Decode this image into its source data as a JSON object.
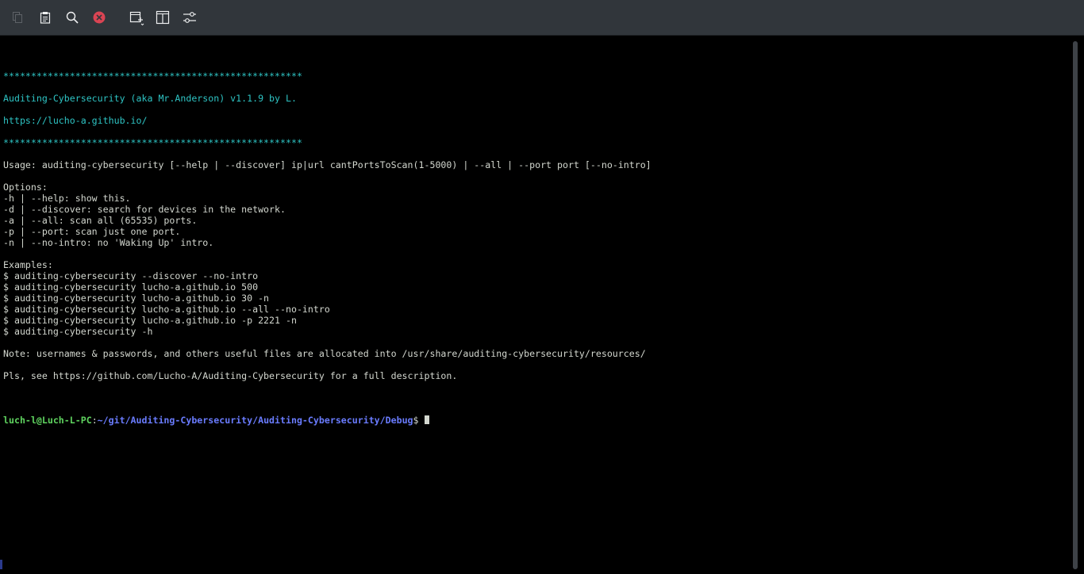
{
  "toolbar": {
    "buttons": [
      {
        "name": "copy",
        "icon": "copy-icon",
        "enabled": false
      },
      {
        "name": "paste",
        "icon": "paste-icon",
        "enabled": true
      },
      {
        "name": "find",
        "icon": "search-icon",
        "enabled": true
      },
      {
        "name": "close",
        "icon": "close-icon",
        "enabled": true,
        "color": "#da4453"
      },
      {
        "name": "new-tab",
        "icon": "new-tab-icon",
        "enabled": true
      },
      {
        "name": "split-view",
        "icon": "split-view-icon",
        "enabled": true
      },
      {
        "name": "settings",
        "icon": "settings-sliders-icon",
        "enabled": true
      }
    ]
  },
  "colors": {
    "toolbar_bg": "#31363b",
    "terminal_bg": "#000000",
    "text": "#d3d7cf",
    "cyan": "#2ec4c4",
    "prompt_user": "#5fd35f",
    "prompt_path": "#6a7cff",
    "close_red": "#da4453"
  },
  "terminal": {
    "lines": [
      {
        "text": "******************************************************",
        "style": "cyan"
      },
      {
        "text": "",
        "style": ""
      },
      {
        "text": "Auditing-Cybersecurity (aka Mr.Anderson) v1.1.9 by L.",
        "style": "cyan"
      },
      {
        "text": "",
        "style": ""
      },
      {
        "text": "https://lucho-a.github.io/",
        "style": "cyan"
      },
      {
        "text": "",
        "style": ""
      },
      {
        "text": "******************************************************",
        "style": "cyan"
      },
      {
        "text": "",
        "style": ""
      },
      {
        "text": "Usage: auditing-cybersecurity [--help | --discover] ip|url cantPortsToScan(1-5000) | --all | --port port [--no-intro]",
        "style": ""
      },
      {
        "text": "",
        "style": ""
      },
      {
        "text": "Options:",
        "style": ""
      },
      {
        "text": "-h | --help: show this.",
        "style": ""
      },
      {
        "text": "-d | --discover: search for devices in the network.",
        "style": ""
      },
      {
        "text": "-a | --all: scan all (65535) ports.",
        "style": ""
      },
      {
        "text": "-p | --port: scan just one port.",
        "style": ""
      },
      {
        "text": "-n | --no-intro: no 'Waking Up' intro.",
        "style": ""
      },
      {
        "text": "",
        "style": ""
      },
      {
        "text": "Examples:",
        "style": ""
      },
      {
        "text": "$ auditing-cybersecurity --discover --no-intro",
        "style": ""
      },
      {
        "text": "$ auditing-cybersecurity lucho-a.github.io 500",
        "style": ""
      },
      {
        "text": "$ auditing-cybersecurity lucho-a.github.io 30 -n",
        "style": ""
      },
      {
        "text": "$ auditing-cybersecurity lucho-a.github.io --all --no-intro",
        "style": ""
      },
      {
        "text": "$ auditing-cybersecurity lucho-a.github.io -p 2221 -n",
        "style": ""
      },
      {
        "text": "$ auditing-cybersecurity -h",
        "style": ""
      },
      {
        "text": "",
        "style": ""
      },
      {
        "text": "Note: usernames & passwords, and others useful files are allocated into /usr/share/auditing-cybersecurity/resources/",
        "style": ""
      },
      {
        "text": "",
        "style": ""
      },
      {
        "text": "Pls, see https://github.com/Lucho-A/Auditing-Cybersecurity for a full description.",
        "style": ""
      },
      {
        "text": "",
        "style": ""
      }
    ],
    "prompt": {
      "user_host": "luch-l@Luch-L-PC",
      "separator": ":",
      "path": "~/git/Auditing-Cybersecurity/Auditing-Cybersecurity/Debug",
      "symbol": "$ "
    }
  }
}
